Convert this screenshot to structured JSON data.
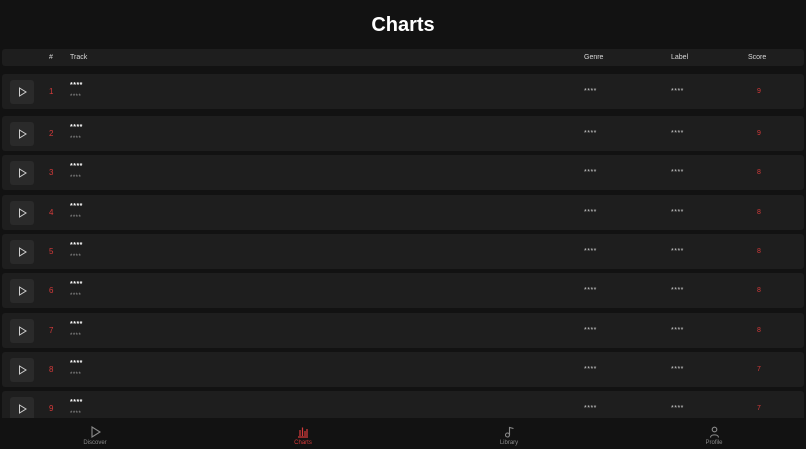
{
  "page": {
    "title": "Charts"
  },
  "table": {
    "headers": {
      "num": "#",
      "track": "Track",
      "genre": "Genre",
      "label": "Label",
      "score": "Score"
    },
    "rows": [
      {
        "rank": "1",
        "title": "****",
        "artist": "****",
        "genre": "****",
        "label": "****",
        "score": "9"
      },
      {
        "rank": "2",
        "title": "****",
        "artist": "****",
        "genre": "****",
        "label": "****",
        "score": "9"
      },
      {
        "rank": "3",
        "title": "****",
        "artist": "****",
        "genre": "****",
        "label": "****",
        "score": "8"
      },
      {
        "rank": "4",
        "title": "****",
        "artist": "****",
        "genre": "****",
        "label": "****",
        "score": "8"
      },
      {
        "rank": "5",
        "title": "****",
        "artist": "****",
        "genre": "****",
        "label": "****",
        "score": "8"
      },
      {
        "rank": "6",
        "title": "****",
        "artist": "****",
        "genre": "****",
        "label": "****",
        "score": "8"
      },
      {
        "rank": "7",
        "title": "****",
        "artist": "****",
        "genre": "****",
        "label": "****",
        "score": "8"
      },
      {
        "rank": "8",
        "title": "****",
        "artist": "****",
        "genre": "****",
        "label": "****",
        "score": "7"
      },
      {
        "rank": "9",
        "title": "****",
        "artist": "****",
        "genre": "****",
        "label": "****",
        "score": "7"
      }
    ]
  },
  "nav": {
    "items": [
      {
        "label": "Discover",
        "icon": "play-icon",
        "active": false
      },
      {
        "label": "Charts",
        "icon": "bar-chart-icon",
        "active": true
      },
      {
        "label": "Library",
        "icon": "music-note-icon",
        "active": false
      },
      {
        "label": "Profile",
        "icon": "user-icon",
        "active": false
      }
    ]
  },
  "colors": {
    "accent": "#d63a3a",
    "background": "#121212",
    "row": "#1e1e1e"
  }
}
